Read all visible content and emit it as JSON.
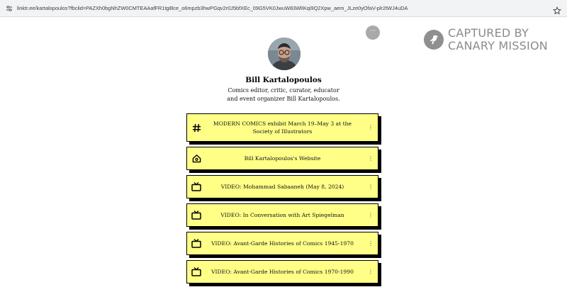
{
  "browser": {
    "url": "linktr.ee/kartalopoulos?fbclid=PAZXh0bgNhZW0CMTEAAafFR1tg8lce_o6mpzb3hwPGqv2r0J5bfXEc_09G5VK0JwuW83WlIKqi9Q2Xpw_aem_JLze0yOfaV-plr2tWJ4uDA"
  },
  "watermark": {
    "line1": "CAPTURED BY",
    "line2": "CANARY MISSION"
  },
  "profile": {
    "more_glyph": "···",
    "name": "Bill Kartalopoulos",
    "bio_line1": "Comics editor, critic, curator, educator",
    "bio_line2": "and event organizer Bill Kartalopoulos."
  },
  "links": [
    {
      "icon": "hashtag-icon",
      "label": "MODERN COMICS exhibit March 19–May 3 at the Society of Illustrators",
      "dots": "⋮"
    },
    {
      "icon": "home-icon",
      "label": "Bill Kartalopoulos's Website",
      "dots": "⋮"
    },
    {
      "icon": "tv-icon",
      "label": "VIDEO: Mohammad Sabaaneh (May 8, 2024)",
      "dots": "⋮"
    },
    {
      "icon": "tv-icon",
      "label": "VIDEO: In Conversation with Art Spiegelman",
      "dots": "⋮"
    },
    {
      "icon": "tv-icon",
      "label": "VIDEO: Avant-Garde Histories of Comics 1945-1970",
      "dots": "⋮"
    },
    {
      "icon": "tv-icon",
      "label": "VIDEO: Avant-Garde Histories of Comics 1970-1990",
      "dots": "⋮"
    }
  ],
  "colors": {
    "link_fill": "#ffff88",
    "link_border": "#000000",
    "watermark": "#8b8b8b"
  }
}
